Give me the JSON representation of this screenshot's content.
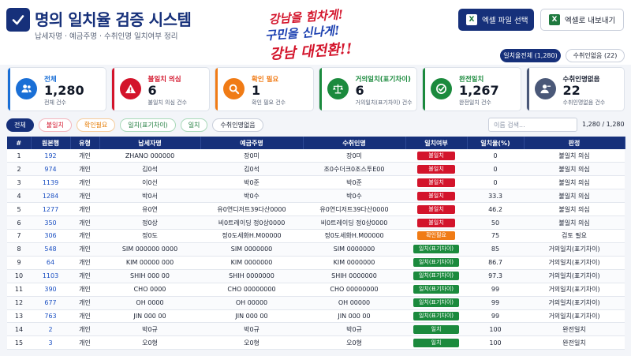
{
  "header": {
    "title": "명의 일치율 검증 시스템",
    "subtitle": "납세자명 · 예금주명 · 수취인명 일치여부 정리",
    "slogan": [
      "강남을 힘차게!",
      "구민을 신나게!",
      "강남 대전환!!"
    ]
  },
  "toolbar": {
    "select_excel_label": "엑셀 파일 선택",
    "export_excel_label": "엑셀로 내보내기",
    "excel_icon_glyph": "X"
  },
  "quick_filters": {
    "all_mismatch": "일치율전체 (1,280)",
    "no_recipient": "수취인없음 (22)"
  },
  "cards": [
    {
      "title": "전체",
      "value": "1,280",
      "sub": "전체 건수",
      "color": "#1a6fd6",
      "icon": "users-icon"
    },
    {
      "title": "불일치 의심",
      "value": "6",
      "sub": "불일치 의심 건수",
      "color": "#d3142b",
      "icon": "warning-icon"
    },
    {
      "title": "확인 필요",
      "value": "1",
      "sub": "확인 필요 건수",
      "color": "#f07b15",
      "icon": "search-icon"
    },
    {
      "title": "거의일치(표기차이)",
      "value": "6",
      "sub": "거의일치(표기차이) 건수",
      "color": "#1b8a3d",
      "icon": "scale-icon"
    },
    {
      "title": "완전일치",
      "value": "1,267",
      "sub": "완전일치 건수",
      "color": "#1b8a3d",
      "icon": "check-circle-icon"
    },
    {
      "title": "수취인명없음",
      "value": "22",
      "sub": "수취인명없음 건수",
      "color": "#4a5878",
      "icon": "user-minus-icon"
    }
  ],
  "filters": {
    "chips": [
      "전체",
      "불일치",
      "확인필요",
      "일치(표기차이)",
      "일치",
      "수취인명없음"
    ],
    "search_placeholder": "이름 검색...",
    "count": "1,280 / 1,280"
  },
  "table": {
    "headers": [
      "#",
      "원본행",
      "유형",
      "납세자명",
      "예금주명",
      "수취인명",
      "일치여부",
      "일치율(%)",
      "판정"
    ],
    "rows": [
      [
        "1",
        "192",
        "개인",
        "ZHANO  000000",
        "장0미",
        "장0미",
        "불일치",
        "0",
        "불일치 의심"
      ],
      [
        "2",
        "974",
        "개인",
        "김0석",
        "김0석",
        "조0수더크0조스투E00",
        "불일치",
        "0",
        "불일치 의심"
      ],
      [
        "3",
        "1139",
        "개인",
        "이0선",
        "박0준",
        "박0준",
        "불일치",
        "0",
        "불일치 의심"
      ],
      [
        "4",
        "1284",
        "개인",
        "박0서",
        "박0수",
        "박0수",
        "불일치",
        "33.3",
        "불일치 의심"
      ],
      [
        "5",
        "1277",
        "개인",
        "유0연",
        "유0연디저트39다산0000",
        "유0연디저트39다산0000",
        "불일치",
        "46.2",
        "불일치 의심"
      ],
      [
        "6",
        "350",
        "개인",
        "정0상",
        "비0트레이딩 정0상0000",
        "비0트레이딩 정0상0000",
        "불일치",
        "50",
        "불일치 의심"
      ],
      [
        "7",
        "306",
        "개인",
        "정0도",
        "정0도세화H.M00000",
        "정0도세화H.M00000",
        "확인필요",
        "75",
        "검토 필요"
      ],
      [
        "8",
        "548",
        "개인",
        "SIM 000000 0000",
        "SIM 0000000",
        "SIM 0000000",
        "일치(표기차이)",
        "85",
        "거의일치(표기차이)"
      ],
      [
        "9",
        "64",
        "개인",
        "KIM 00000 000",
        "KIM 0000000",
        "KIM 0000000",
        "일치(표기차이)",
        "86.7",
        "거의일치(표기차이)"
      ],
      [
        "10",
        "1103",
        "개인",
        "SHIH 000 00",
        "SHIH 0000000",
        "SHIH 0000000",
        "일치(표기차이)",
        "97.3",
        "거의일치(표기차이)"
      ],
      [
        "11",
        "390",
        "개인",
        "CHO 0000",
        "CHO 00000000",
        "CHO 00000000",
        "일치(표기차이)",
        "99",
        "거의일치(표기차이)"
      ],
      [
        "12",
        "677",
        "개인",
        "OH 0000",
        "OH 00000",
        "OH 00000",
        "일치(표기차이)",
        "99",
        "거의일치(표기차이)"
      ],
      [
        "13",
        "763",
        "개인",
        "JIN 000  00",
        "JIN 000   00",
        "JIN 000   00",
        "일치(표기차이)",
        "99",
        "거의일치(표기차이)"
      ],
      [
        "14",
        "2",
        "개인",
        "박0규",
        "박0규",
        "박0규",
        "일치",
        "100",
        "완전일치"
      ],
      [
        "15",
        "3",
        "개인",
        "오0형",
        "오0형",
        "오0형",
        "일치",
        "100",
        "완전일치"
      ]
    ]
  }
}
